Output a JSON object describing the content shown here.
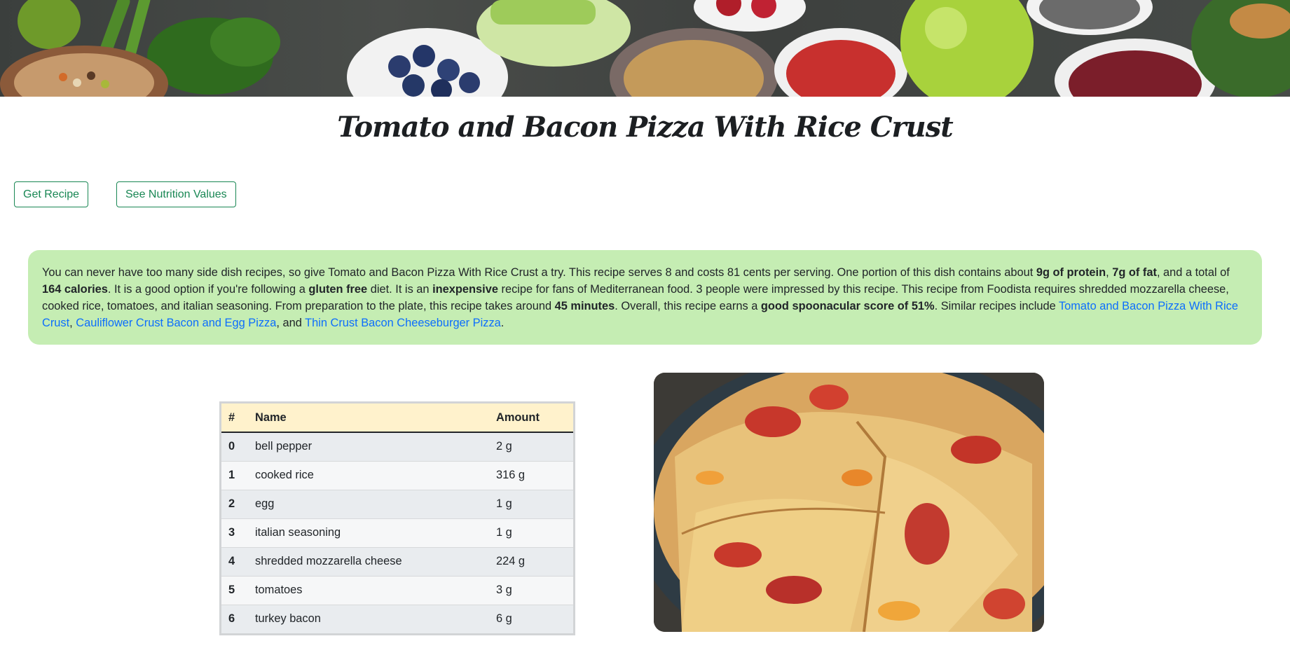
{
  "page": {
    "title": "Tomato and Bacon Pizza With Rice Crust"
  },
  "buttons": {
    "get_recipe": "Get Recipe",
    "see_nutrition": "See Nutrition Values"
  },
  "summary": {
    "p1": "You can never have too many side dish recipes, so give Tomato and Bacon Pizza With Rice Crust a try. This recipe serves 8 and costs 81 cents per serving. One portion of this dish contains about ",
    "b_protein": "9g of protein",
    "p2": ", ",
    "b_fat": "7g of fat",
    "p3": ", and a total of ",
    "b_calories": "164 calories",
    "p4": ". It is a good option if you're following a ",
    "b_gluten": "gluten free",
    "p5": " diet. It is an ",
    "b_inexpensive": "inexpensive",
    "p6": " recipe for fans of Mediterranean food. 3 people were impressed by this recipe. This recipe from Foodista requires shredded mozzarella cheese, cooked rice, tomatoes, and italian seasoning. From preparation to the plate, this recipe takes around ",
    "b_minutes": "45 minutes",
    "p7": ". Overall, this recipe earns a ",
    "b_score": "good spoonacular score of 51%",
    "p8": ". Similar recipes include ",
    "link1": "Tomato and Bacon Pizza With Rice Crust",
    "p9": ", ",
    "link2": "Cauliflower Crust Bacon and Egg Pizza",
    "p10": ", and ",
    "link3": "Thin Crust Bacon Cheeseburger Pizza",
    "p11": "."
  },
  "ingredients": {
    "headers": [
      "#",
      "Name",
      "Amount"
    ],
    "rows": [
      {
        "idx": "0",
        "name": "bell pepper",
        "amount": "2 g"
      },
      {
        "idx": "1",
        "name": "cooked rice",
        "amount": "316 g"
      },
      {
        "idx": "2",
        "name": "egg",
        "amount": "1 g"
      },
      {
        "idx": "3",
        "name": "italian seasoning",
        "amount": "1 g"
      },
      {
        "idx": "4",
        "name": "shredded mozzarella cheese",
        "amount": "224 g"
      },
      {
        "idx": "5",
        "name": "tomatoes",
        "amount": "3 g"
      },
      {
        "idx": "6",
        "name": "turkey bacon",
        "amount": "6 g"
      }
    ]
  },
  "colors": {
    "accent_green": "#198754",
    "summary_bg": "#c5edb3",
    "link_blue": "#0d6efd",
    "table_header_bg": "#fff2cc"
  }
}
